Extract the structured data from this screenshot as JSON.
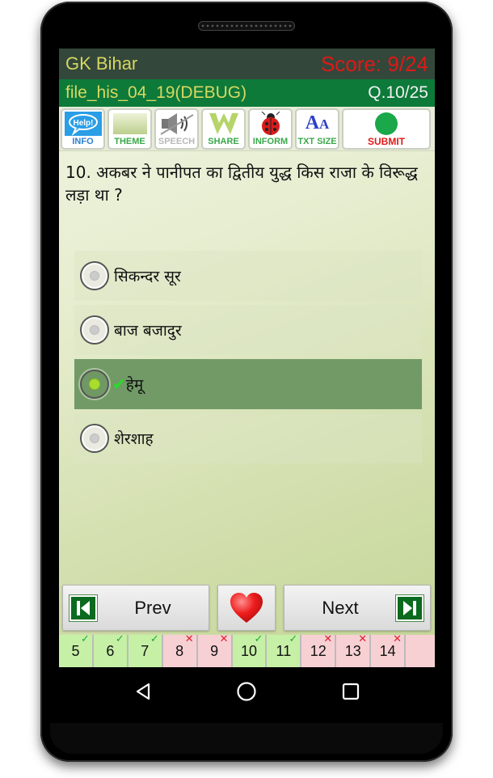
{
  "header": {
    "app_title": "GK Bihar",
    "score": "Score: 9/24",
    "file_name": "file_his_04_19(DEBUG)",
    "question_counter": "Q.10/25"
  },
  "toolbar": {
    "items": [
      {
        "label": "INFO",
        "icon": "help-bubble-icon",
        "color": "#2a7fd0"
      },
      {
        "label": "THEME",
        "icon": "theme-swatch-icon",
        "color": "#3aa84a"
      },
      {
        "label": "SPEECH",
        "icon": "speaker-muted-icon",
        "color": "#b9b9b9"
      },
      {
        "label": "SHARE",
        "icon": "share-w-icon",
        "color": "#3aa84a"
      },
      {
        "label": "INFORM",
        "icon": "ladybug-icon",
        "color": "#3aa84a"
      },
      {
        "label": "TXT SIZE",
        "icon": "text-size-icon",
        "color": "#3aa84a"
      },
      {
        "label": "SUBMIT",
        "icon": "green-dot-icon",
        "color": "#e01818"
      }
    ]
  },
  "question": {
    "text": "10. अकबर ने पानीपत का द्वितीय युद्ध किस राजा के विरूद्ध लड़ा था ?"
  },
  "options": [
    {
      "text": "सिकन्दर सूर",
      "selected": false,
      "correct": false
    },
    {
      "text": "बाज बजादुर",
      "selected": false,
      "correct": false
    },
    {
      "text": "हेमू",
      "selected": true,
      "correct": true,
      "check_mark": "✔"
    },
    {
      "text": "शेरशाह",
      "selected": false,
      "correct": false
    }
  ],
  "navigation": {
    "prev_label": "Prev",
    "next_label": "Next"
  },
  "question_tiles": [
    {
      "number": "5",
      "status": "correct",
      "mark": "✓"
    },
    {
      "number": "6",
      "status": "correct",
      "mark": "✓"
    },
    {
      "number": "7",
      "status": "correct",
      "mark": "✓"
    },
    {
      "number": "8",
      "status": "wrong",
      "mark": "✕"
    },
    {
      "number": "9",
      "status": "wrong",
      "mark": "✕"
    },
    {
      "number": "10",
      "status": "correct",
      "mark": "✓"
    },
    {
      "number": "11",
      "status": "correct",
      "mark": "✓"
    },
    {
      "number": "12",
      "status": "wrong",
      "mark": "✕"
    },
    {
      "number": "13",
      "status": "wrong",
      "mark": "✕"
    },
    {
      "number": "14",
      "status": "wrong",
      "mark": "✕"
    },
    {
      "number": "",
      "status": "wrong",
      "mark": ""
    }
  ],
  "colors": {
    "title_bar": "#33473a",
    "sub_bar": "#0d7a3a",
    "score": "#e01818",
    "selected_option": "#719a67",
    "tile_correct": "#c6f0a6",
    "tile_wrong": "#f7d0d4"
  }
}
